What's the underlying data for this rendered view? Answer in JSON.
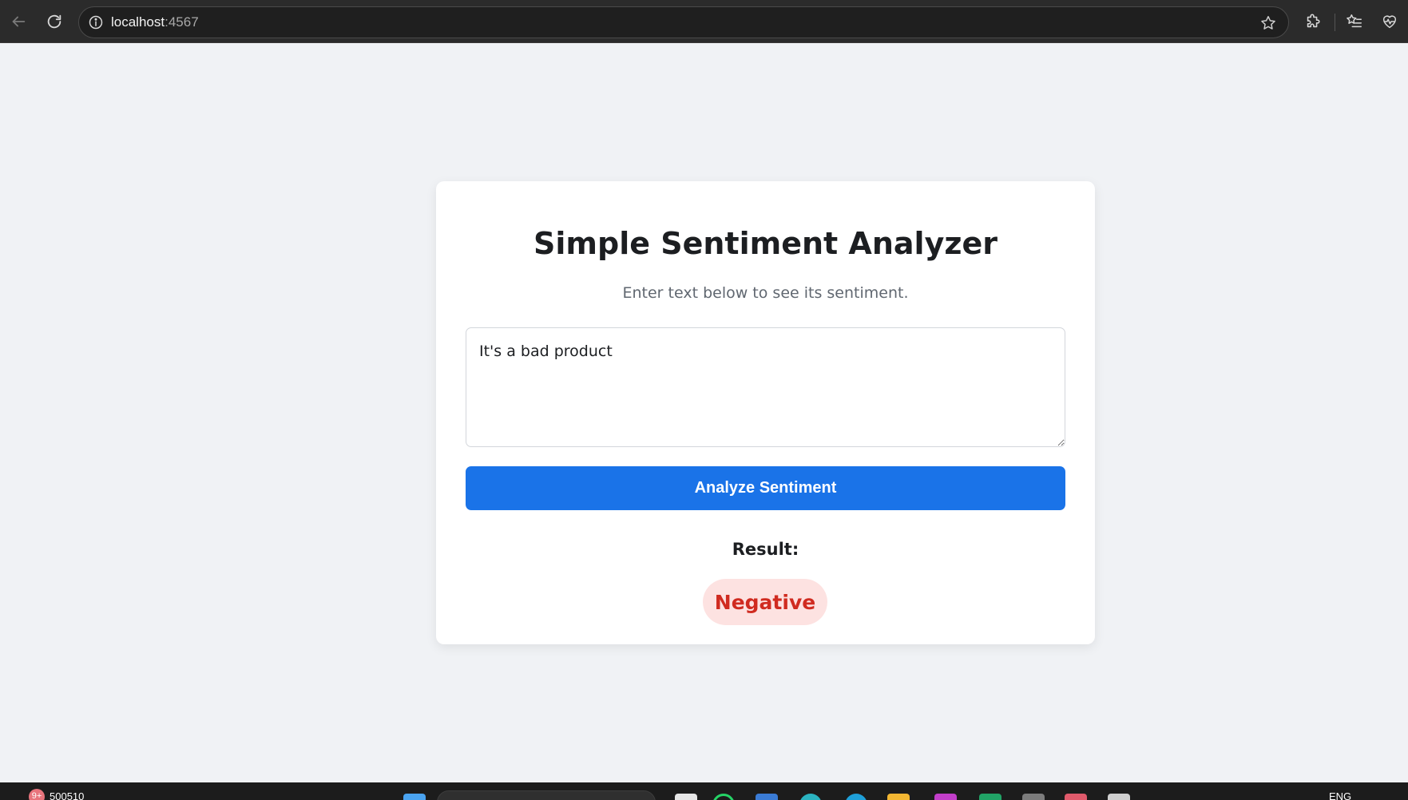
{
  "browser": {
    "url_host": "localhost",
    "url_port": ":4567"
  },
  "app": {
    "title": "Simple Sentiment Analyzer",
    "subtitle": "Enter text below to see its sentiment.",
    "input_value": "It's a bad product",
    "button_label": "Analyze Sentiment",
    "result_label": "Result:",
    "result_value": "Negative",
    "colors": {
      "button": "#1a73e8",
      "negative_text": "#d02b20",
      "negative_bg": "#fde2e1"
    }
  },
  "taskbar": {
    "notification_count": "9+",
    "ticker": "500510",
    "language": "ENG"
  }
}
